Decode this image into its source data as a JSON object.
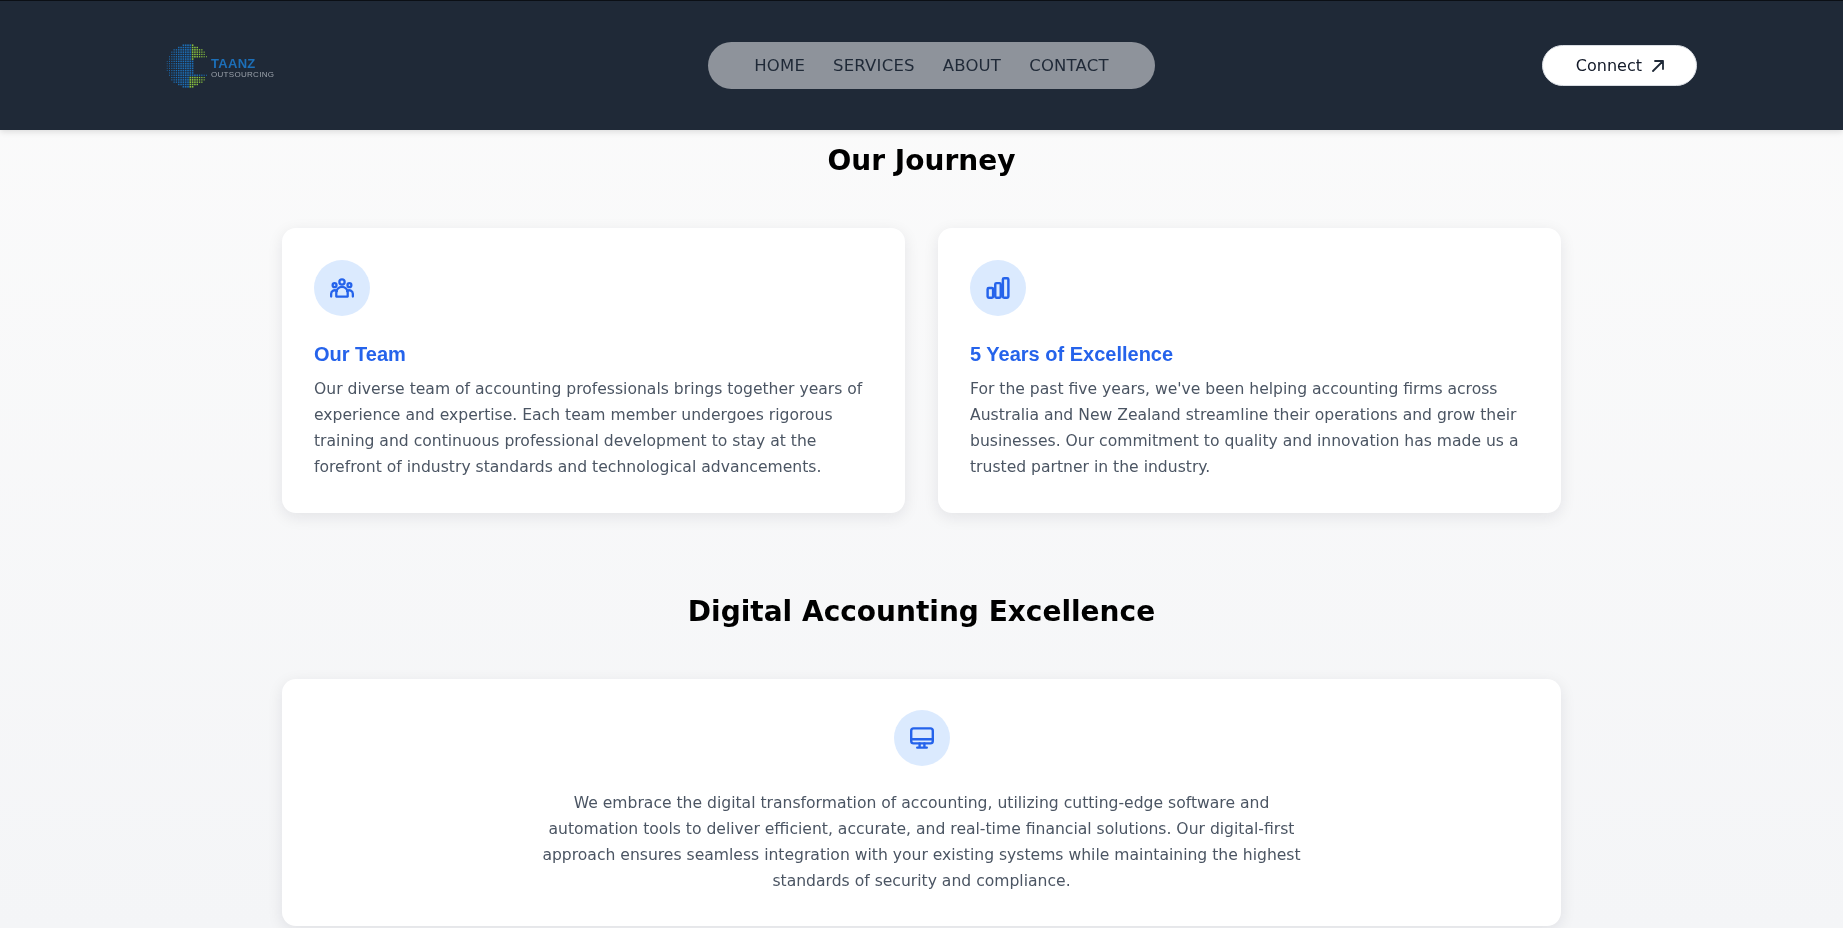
{
  "header": {
    "logo": {
      "name": "TAANZ",
      "tagline": "OUTSOURCING"
    },
    "nav": [
      {
        "label": "HOME"
      },
      {
        "label": "SERVICES"
      },
      {
        "label": "ABOUT"
      },
      {
        "label": "CONTACT"
      }
    ],
    "connect_button": {
      "label": "Connect"
    }
  },
  "sections": [
    {
      "title": "Our Journey",
      "cards": [
        {
          "kind": "tile",
          "title": "Our Team",
          "text": "Our diverse team of accounting professionals brings together years of experience and expertise. Each team member undergoes rigorous training and continuous professional development to stay at the forefront of industry standards and technological advancements."
        },
        {
          "kind": "tile",
          "title": "5 Years of Excellence",
          "text": "For the past five years, we've been helping accounting firms across Australia and New Zealand streamline their operations and grow their businesses. Our commitment to quality and innovation has made us a trusted partner in the industry."
        }
      ]
    },
    {
      "title": "Digital Accounting Excellence",
      "cards": [
        {
          "kind": "banner",
          "text": "We embrace the digital transformation of accounting, utilizing cutting-edge software and automation tools to deliver efficient, accurate, and real-time financial solutions. Our digital-first approach ensures seamless integration with your existing systems while maintaining the highest standards of security and compliance."
        }
      ]
    }
  ]
}
